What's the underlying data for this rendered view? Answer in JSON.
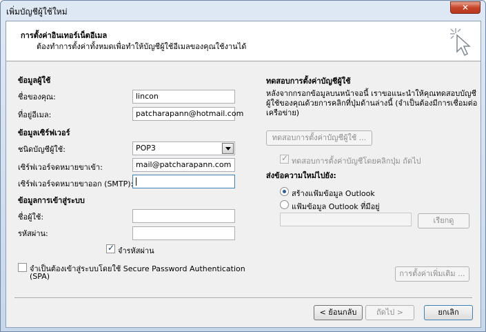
{
  "window": {
    "title": "เพิ่มบัญชีผู้ใช้ใหม่",
    "close_label": "✕"
  },
  "header": {
    "title": "การตั้งค่าอินเทอร์เน็ตอีเมล",
    "subtitle": "ต้องทำการตั้งค่าทั้งหมดเพื่อทำให้บัญชีผู้ใช้อีเมลของคุณใช้งานได้"
  },
  "user_info": {
    "section": "ข้อมูลผู้ใช้",
    "name_label": "ชื่อของคุณ:",
    "name_value": "lincon",
    "email_label": "ที่อยู่อีเมล:",
    "email_value": "patcharapann@hotmail.com"
  },
  "server_info": {
    "section": "ข้อมูลเซิร์ฟเวอร์",
    "account_type_label": "ชนิดบัญชีผู้ใช้:",
    "account_type_value": "POP3",
    "incoming_label": "เซิร์ฟเวอร์จดหมายขาเข้า:",
    "incoming_value": "mail@patcharapann.com",
    "outgoing_label": "เซิร์ฟเวอร์จดหมายขาออก (SMTP):",
    "outgoing_value": ""
  },
  "logon_info": {
    "section": "ข้อมูลการเข้าสู่ระบบ",
    "username_label": "ชื่อผู้ใช้:",
    "username_value": "",
    "password_label": "รหัสผ่าน:",
    "password_value": "",
    "remember_label": "จำรหัสผ่าน",
    "remember_checked": true,
    "spa_label_line1": "จำเป็นต้องเข้าสู่ระบบโดยใช้ Secure Password Authentication",
    "spa_label_line2": "(SPA)",
    "spa_checked": false
  },
  "test_settings": {
    "section": "ทดสอบการตั้งค่าบัญชีผู้ใช้",
    "description_line1": "หลังจากกรอกข้อมูลบนหน้าจอนี้ เราขอแนะนำให้คุณทดสอบบัญชี",
    "description_line2": "ผู้ใช้ของคุณด้วยการคลิกที่ปุ่มด้านล่างนี้ (จำเป็นต้องมีการเชื่อมต่อ",
    "description_line3": "เครือข่าย)",
    "test_button": "ทดสอบการตั้งค่าบัญชีผู้ใช้ ...",
    "auto_test_label": "ทดสอบการตั้งค่าบัญชีโดยคลิกปุ่ม ถัดไป",
    "auto_test_checked": true
  },
  "deliver": {
    "section": "ส่งข้อความใหม่ไปยัง:",
    "new_file_label": "สร้างแฟ้มข้อมูล Outlook",
    "existing_file_label": "แฟ้มข้อมูล Outlook ที่มีอยู่",
    "file_path_value": "",
    "browse_button": "เรียกดู"
  },
  "more_settings_button": "การตั้งค่าเพิ่มเติม ...",
  "footer": {
    "back_button": "< ย้อนกลับ",
    "next_button": "ถัดไป >",
    "cancel_button": "ยกเลิก"
  },
  "colors": {
    "title_bar": "#dfe9f5",
    "dialog_bg": "#f0f0f0",
    "close_button": "#c7452a",
    "radio_dot": "#2d5d96"
  }
}
